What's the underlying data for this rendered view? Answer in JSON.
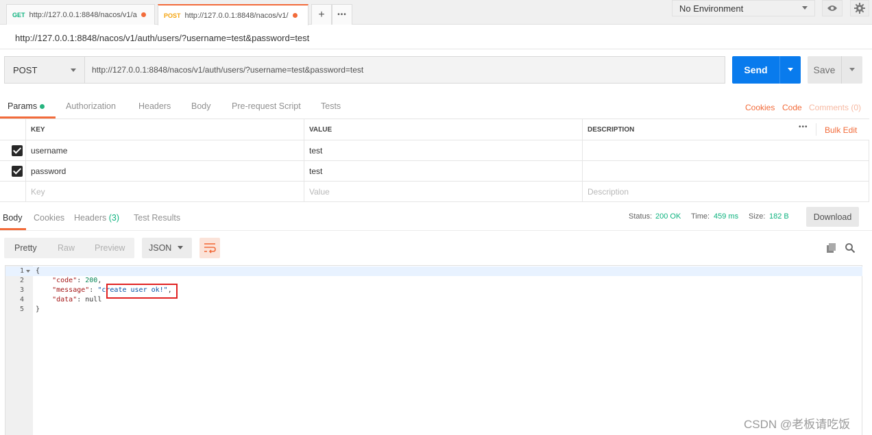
{
  "tabs": [
    {
      "method": "GET",
      "url": "http://127.0.0.1:8848/nacos/v1/a"
    },
    {
      "method": "POST",
      "url": "http://127.0.0.1:8848/nacos/v1/"
    }
  ],
  "tab_actions": {
    "add": "+",
    "more": "•••"
  },
  "environment": {
    "selected": "No Environment"
  },
  "request": {
    "title": "http://127.0.0.1:8848/nacos/v1/auth/users/?username=test&password=test",
    "method": "POST",
    "url": "http://127.0.0.1:8848/nacos/v1/auth/users/?username=test&password=test",
    "send_label": "Send",
    "save_label": "Save"
  },
  "request_tabs": [
    "Params",
    "Authorization",
    "Headers",
    "Body",
    "Pre-request Script",
    "Tests"
  ],
  "request_links": {
    "cookies": "Cookies",
    "code": "Code",
    "comments": "Comments (0)"
  },
  "params": {
    "headers": {
      "key": "KEY",
      "value": "VALUE",
      "description": "DESCRIPTION",
      "more": "•••",
      "bulk_edit": "Bulk Edit"
    },
    "rows": [
      {
        "key": "username",
        "value": "test",
        "description": ""
      },
      {
        "key": "password",
        "value": "test",
        "description": ""
      }
    ],
    "placeholders": {
      "key": "Key",
      "value": "Value",
      "description": "Description"
    }
  },
  "response_tabs": [
    "Body",
    "Cookies",
    "Headers",
    "(3)",
    "Test Results"
  ],
  "response_status": {
    "status_label": "Status:",
    "status": "200 OK",
    "time_label": "Time:",
    "time": "459 ms",
    "size_label": "Size:",
    "size": "182 B",
    "download_label": "Download"
  },
  "format_bar": {
    "pretty": "Pretty",
    "raw": "Raw",
    "preview": "Preview",
    "language": "JSON"
  },
  "response_body": {
    "line_numbers": [
      "1",
      "2",
      "3",
      "4",
      "5"
    ],
    "open_brace": "{",
    "code_key": "\"code\"",
    "code_value": "200",
    "message_key": "\"message\"",
    "message_value": "create user ok!",
    "data_key": "\"data\"",
    "data_value": "null",
    "close_brace": "}"
  },
  "watermark": "CSDN @老板请吃饭"
}
